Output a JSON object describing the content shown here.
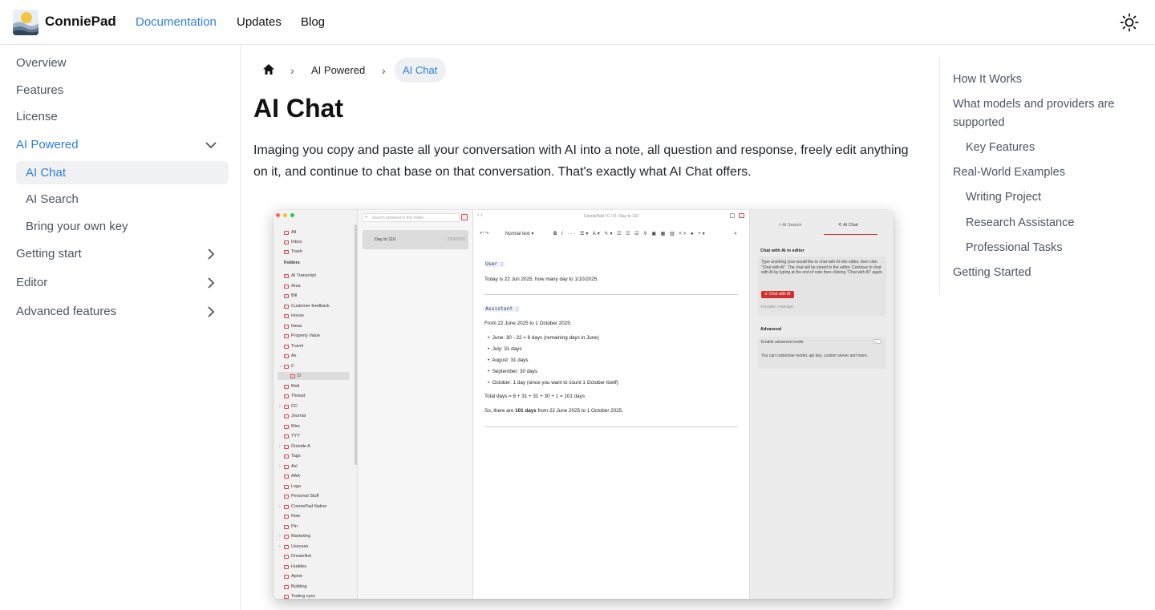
{
  "header": {
    "brand": "ConniePad",
    "nav": [
      "Documentation",
      "Updates",
      "Blog"
    ]
  },
  "sidebar": {
    "items": [
      {
        "label": "Overview"
      },
      {
        "label": "Features"
      },
      {
        "label": "License"
      },
      {
        "label": "AI Powered"
      },
      {
        "label": "AI Chat"
      },
      {
        "label": "AI Search"
      },
      {
        "label": "Bring your own key"
      },
      {
        "label": "Getting start"
      },
      {
        "label": "Editor"
      },
      {
        "label": "Advanced features"
      }
    ]
  },
  "breadcrumb": [
    "AI Powered",
    "AI Chat"
  ],
  "page": {
    "title": "AI Chat",
    "intro": "Imaging you copy and paste all your conversation with AI into a note, all question and response, freely edit anything on it, and continue to chat base on that conversation. That's exactly what AI Chat offers."
  },
  "toc": [
    "How It Works",
    "What models and providers are supported",
    "Key Features",
    "Real-World Examples",
    "Writing Project",
    "Research Assistance",
    "Professional Tasks",
    "Getting Started"
  ],
  "app": {
    "search_placeholder": "Search keyword in this folder",
    "path": "ConniePad / C / D / Day to 110",
    "note_title": "Day to 110",
    "note_date": "23/6/2025",
    "top_items": [
      "All",
      "Inbox",
      "Trash"
    ],
    "folders_label": "Folders",
    "folders": [
      "AI Transcript",
      "Area",
      "Bill",
      "Customer feedback",
      "House",
      "Ideas",
      "Property Value",
      "Travel",
      "As",
      "C",
      "D",
      "Mail",
      "Thread",
      "CC",
      "Journal",
      "Misc",
      "YYY",
      "Outside A",
      "Tags",
      "Axl",
      "AAA",
      "Logo",
      "Personal Stuff",
      "ConniePad Native",
      "Now",
      "Pin",
      "Marketing",
      "Usecase",
      "DreamNet",
      "Huddes",
      "Apine",
      "Building",
      "Testing sync"
    ],
    "toolbar_style": "Normal text",
    "user_label": "User :",
    "user_message": "Today is 22 Jun 2025. how many day to 1/10/2025.",
    "assistant_label": "Assistant :",
    "answer_intro": "From 22 June 2025 to 1 October 2025:",
    "answer_bullets": [
      "June: 30 - 22 = 8 days (remaining days in June)",
      "July: 31 days",
      "August: 31 days",
      "September: 30 days",
      "October: 1 day (since you want to count 1 October itself)"
    ],
    "answer_total": "Total days = 8 + 31 + 31 + 30 + 1 = 101 days",
    "answer_conclusion_pre": "So, there are ",
    "answer_conclusion_bold": "101 days",
    "answer_conclusion_post": " from 22 June 2025 to 1 October 2025.",
    "ai_tab_search": "AI Search",
    "ai_tab_chat": "AI Chat",
    "ai_card_title": "Chat with AI in editor",
    "ai_card_desc": "Type anything your would like to chat with AI into editor, then click \"Chat with AI\". The chat will be stored in the editor. Continue to chat with AI by typing at the end of note then clicking \"Chat with AI\" again.",
    "ai_button": "Chat with AI",
    "ai_provider": "Provider: Anthropic",
    "advanced_label": "Advanced",
    "advanced_toggle": "Enable advanced mode",
    "advanced_desc": "You can customise model, api key, custom server and more."
  },
  "colors": {
    "accent": "#2f7ed8",
    "app_red": "#d32f2f"
  }
}
